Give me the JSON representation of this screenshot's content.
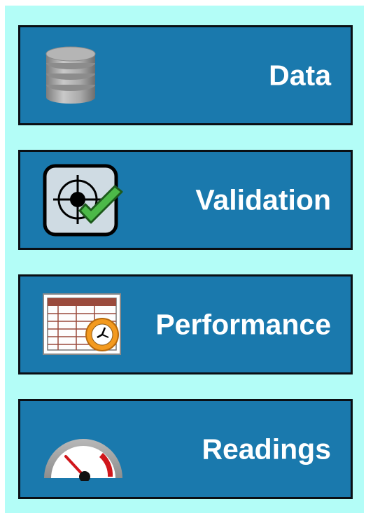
{
  "menu": {
    "items": [
      {
        "label": "Data",
        "icon": "database-icon"
      },
      {
        "label": "Validation",
        "icon": "target-check-icon"
      },
      {
        "label": "Performance",
        "icon": "schedule-clock-icon"
      },
      {
        "label": "Readings",
        "icon": "gauge-icon"
      }
    ]
  },
  "colors": {
    "panel_background": "#b3fdf7",
    "button_background": "#1a79ad",
    "button_border": "#0a0f14",
    "label_text": "#ffffff"
  }
}
